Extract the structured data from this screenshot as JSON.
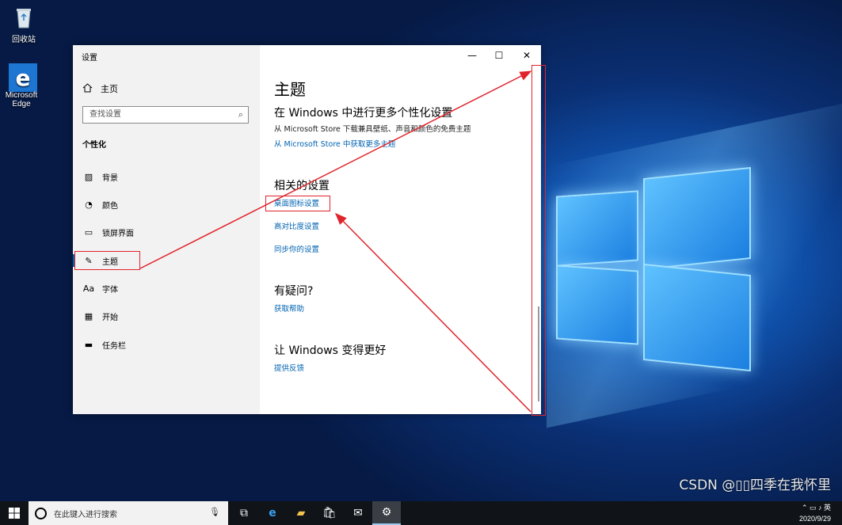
{
  "desktop": {
    "icons": [
      {
        "label": "回收站",
        "icon": "recycle-bin-icon"
      },
      {
        "label": "Microsoft Edge",
        "icon": "edge-icon"
      }
    ]
  },
  "window": {
    "title": "设置",
    "buttons": {
      "minimize": "—",
      "maximize": "☐",
      "close": "✕"
    },
    "sidebar": {
      "home_label": "主页",
      "search_placeholder": "查找设置",
      "section_heading": "个性化",
      "items": [
        {
          "label": "背景",
          "icon": "image-icon"
        },
        {
          "label": "颜色",
          "icon": "palette-icon"
        },
        {
          "label": "锁屏界面",
          "icon": "lock-screen-icon"
        },
        {
          "label": "主题",
          "icon": "brush-icon",
          "active": true
        },
        {
          "label": "字体",
          "icon": "font-icon"
        },
        {
          "label": "开始",
          "icon": "start-icon"
        },
        {
          "label": "任务栏",
          "icon": "taskbar-icon"
        }
      ]
    },
    "content": {
      "title": "主题",
      "more_heading": "在 Windows 中进行更多个性化设置",
      "more_text": "从 Microsoft Store 下载兼具壁纸、声音和颜色的免费主题",
      "more_link": "从 Microsoft Store 中获取更多主题",
      "related_heading": "相关的设置",
      "related_links": [
        "桌面图标设置",
        "高对比度设置",
        "同步你的设置"
      ],
      "help_heading": "有疑问?",
      "help_link": "获取帮助",
      "improve_heading": "让 Windows 变得更好",
      "improve_link": "提供反馈"
    }
  },
  "taskbar": {
    "search_placeholder": "在此键入进行搜索",
    "date": "2020/9/29",
    "accent_color": "#9ac8f0"
  },
  "watermark": "CSDN @▯▯四季在我怀里",
  "colors": {
    "annotation": "#e0242c",
    "link": "#0063b1"
  }
}
